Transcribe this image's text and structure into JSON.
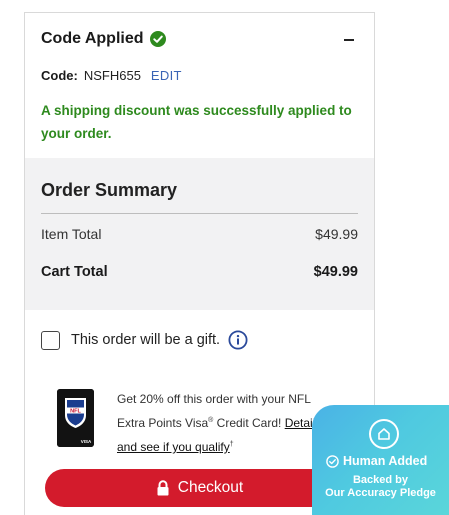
{
  "coupon": {
    "header": "Code Applied",
    "code_label": "Code:",
    "code_value": "NSFH655",
    "edit_label": "EDIT",
    "success_message": "A shipping discount was successfully applied to your order."
  },
  "summary": {
    "title": "Order Summary",
    "item_total_label": "Item Total",
    "item_total_value": "$49.99",
    "cart_total_label": "Cart Total",
    "cart_total_value": "$49.99"
  },
  "gift": {
    "label": "This order will be a gift.",
    "checked": false
  },
  "promo": {
    "text_before": "Get 20% off this order with your NFL Extra Points Visa",
    "reg_mark": "®",
    "text_after": " Credit Card! ",
    "link": "Details and see if you qualify",
    "dagger": "†",
    "card_brand": "NFL",
    "card_network": "VISA"
  },
  "checkout": {
    "label": "Checkout"
  },
  "badge": {
    "title": "Human Added",
    "line1": "Backed by",
    "line2": "Our Accuracy Pledge"
  },
  "colors": {
    "success_green": "#2e8a1e",
    "checkout_red": "#d31b2c",
    "edit_blue": "#3a64b5",
    "badge_cyan": "#4fc9e0"
  },
  "icons": [
    "check-circle-icon",
    "minus-icon",
    "info-icon",
    "lock-icon",
    "shield-home-icon",
    "check-outline-icon"
  ]
}
